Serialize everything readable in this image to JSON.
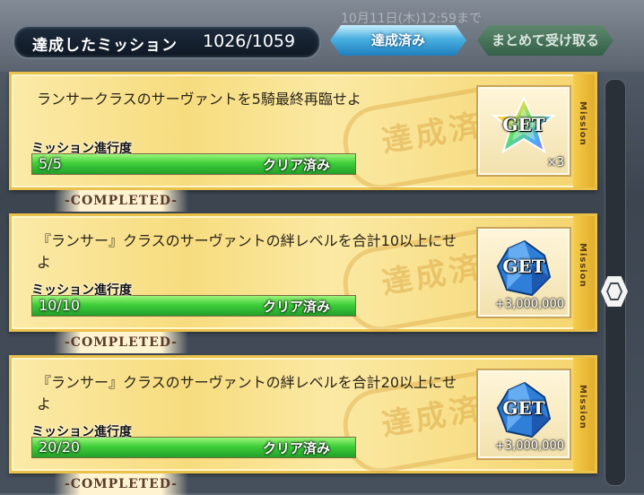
{
  "header": {
    "title": "達成したミッション",
    "count": "1026/1059",
    "tabs": [
      {
        "label": "達成済み",
        "active": true
      },
      {
        "label": "まとめて受け取る",
        "active": false
      }
    ],
    "background_text": "10月11日(木)12:59まで"
  },
  "missions": [
    {
      "description": "ランサークラスのサーヴァントを5騎最終再臨せよ",
      "progress_label": "ミッション進行度",
      "progress": "5/5",
      "progress_fraction": 1.0,
      "status": "クリア済み",
      "stamp": "達成済",
      "side_label": "Mission",
      "reward": {
        "get_label": "GET",
        "quantity": "×3",
        "icon": "saint-quartz-icon"
      }
    },
    {
      "description": "『ランサー』クラスのサーヴァントの絆レベルを合計10以上にせよ",
      "progress_label": "ミッション進行度",
      "progress": "10/10",
      "progress_fraction": 1.0,
      "status": "クリア済み",
      "stamp": "達成済",
      "side_label": "Mission",
      "reward": {
        "get_label": "GET",
        "quantity": "+3,000,000",
        "icon": "qp-crystal-icon"
      }
    },
    {
      "description": "『ランサー』クラスのサーヴァントの絆レベルを合計20以上にせよ",
      "progress_label": "ミッション進行度",
      "progress": "20/20",
      "progress_fraction": 1.0,
      "status": "クリア済み",
      "stamp": "達成済",
      "side_label": "Mission",
      "reward": {
        "get_label": "GET",
        "quantity": "+3,000,000",
        "icon": "qp-crystal-icon"
      }
    }
  ],
  "completed_label": "-COMPLETED-",
  "colors": {
    "card_gold": "#f7dc7e",
    "progress_green": "#3fcf3a",
    "tab_blue": "#4ab0e0",
    "tab_green": "#2f5f42"
  }
}
